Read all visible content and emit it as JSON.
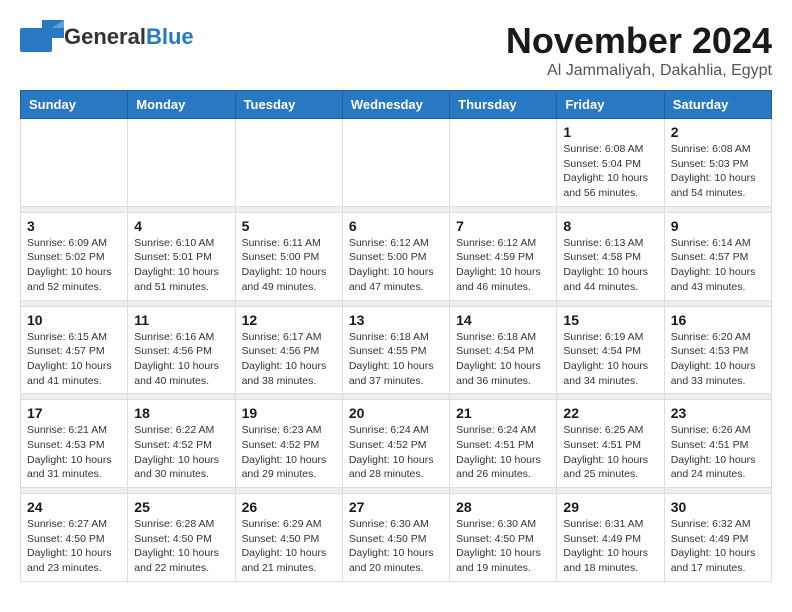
{
  "header": {
    "logo_general": "General",
    "logo_blue": "Blue",
    "month": "November 2024",
    "location": "Al Jammaliyah, Dakahlia, Egypt"
  },
  "weekdays": [
    "Sunday",
    "Monday",
    "Tuesday",
    "Wednesday",
    "Thursday",
    "Friday",
    "Saturday"
  ],
  "weeks": [
    [
      {
        "day": "",
        "info": ""
      },
      {
        "day": "",
        "info": ""
      },
      {
        "day": "",
        "info": ""
      },
      {
        "day": "",
        "info": ""
      },
      {
        "day": "",
        "info": ""
      },
      {
        "day": "1",
        "info": "Sunrise: 6:08 AM\nSunset: 5:04 PM\nDaylight: 10 hours\nand 56 minutes."
      },
      {
        "day": "2",
        "info": "Sunrise: 6:08 AM\nSunset: 5:03 PM\nDaylight: 10 hours\nand 54 minutes."
      }
    ],
    [
      {
        "day": "3",
        "info": "Sunrise: 6:09 AM\nSunset: 5:02 PM\nDaylight: 10 hours\nand 52 minutes."
      },
      {
        "day": "4",
        "info": "Sunrise: 6:10 AM\nSunset: 5:01 PM\nDaylight: 10 hours\nand 51 minutes."
      },
      {
        "day": "5",
        "info": "Sunrise: 6:11 AM\nSunset: 5:00 PM\nDaylight: 10 hours\nand 49 minutes."
      },
      {
        "day": "6",
        "info": "Sunrise: 6:12 AM\nSunset: 5:00 PM\nDaylight: 10 hours\nand 47 minutes."
      },
      {
        "day": "7",
        "info": "Sunrise: 6:12 AM\nSunset: 4:59 PM\nDaylight: 10 hours\nand 46 minutes."
      },
      {
        "day": "8",
        "info": "Sunrise: 6:13 AM\nSunset: 4:58 PM\nDaylight: 10 hours\nand 44 minutes."
      },
      {
        "day": "9",
        "info": "Sunrise: 6:14 AM\nSunset: 4:57 PM\nDaylight: 10 hours\nand 43 minutes."
      }
    ],
    [
      {
        "day": "10",
        "info": "Sunrise: 6:15 AM\nSunset: 4:57 PM\nDaylight: 10 hours\nand 41 minutes."
      },
      {
        "day": "11",
        "info": "Sunrise: 6:16 AM\nSunset: 4:56 PM\nDaylight: 10 hours\nand 40 minutes."
      },
      {
        "day": "12",
        "info": "Sunrise: 6:17 AM\nSunset: 4:56 PM\nDaylight: 10 hours\nand 38 minutes."
      },
      {
        "day": "13",
        "info": "Sunrise: 6:18 AM\nSunset: 4:55 PM\nDaylight: 10 hours\nand 37 minutes."
      },
      {
        "day": "14",
        "info": "Sunrise: 6:18 AM\nSunset: 4:54 PM\nDaylight: 10 hours\nand 36 minutes."
      },
      {
        "day": "15",
        "info": "Sunrise: 6:19 AM\nSunset: 4:54 PM\nDaylight: 10 hours\nand 34 minutes."
      },
      {
        "day": "16",
        "info": "Sunrise: 6:20 AM\nSunset: 4:53 PM\nDaylight: 10 hours\nand 33 minutes."
      }
    ],
    [
      {
        "day": "17",
        "info": "Sunrise: 6:21 AM\nSunset: 4:53 PM\nDaylight: 10 hours\nand 31 minutes."
      },
      {
        "day": "18",
        "info": "Sunrise: 6:22 AM\nSunset: 4:52 PM\nDaylight: 10 hours\nand 30 minutes."
      },
      {
        "day": "19",
        "info": "Sunrise: 6:23 AM\nSunset: 4:52 PM\nDaylight: 10 hours\nand 29 minutes."
      },
      {
        "day": "20",
        "info": "Sunrise: 6:24 AM\nSunset: 4:52 PM\nDaylight: 10 hours\nand 28 minutes."
      },
      {
        "day": "21",
        "info": "Sunrise: 6:24 AM\nSunset: 4:51 PM\nDaylight: 10 hours\nand 26 minutes."
      },
      {
        "day": "22",
        "info": "Sunrise: 6:25 AM\nSunset: 4:51 PM\nDaylight: 10 hours\nand 25 minutes."
      },
      {
        "day": "23",
        "info": "Sunrise: 6:26 AM\nSunset: 4:51 PM\nDaylight: 10 hours\nand 24 minutes."
      }
    ],
    [
      {
        "day": "24",
        "info": "Sunrise: 6:27 AM\nSunset: 4:50 PM\nDaylight: 10 hours\nand 23 minutes."
      },
      {
        "day": "25",
        "info": "Sunrise: 6:28 AM\nSunset: 4:50 PM\nDaylight: 10 hours\nand 22 minutes."
      },
      {
        "day": "26",
        "info": "Sunrise: 6:29 AM\nSunset: 4:50 PM\nDaylight: 10 hours\nand 21 minutes."
      },
      {
        "day": "27",
        "info": "Sunrise: 6:30 AM\nSunset: 4:50 PM\nDaylight: 10 hours\nand 20 minutes."
      },
      {
        "day": "28",
        "info": "Sunrise: 6:30 AM\nSunset: 4:50 PM\nDaylight: 10 hours\nand 19 minutes."
      },
      {
        "day": "29",
        "info": "Sunrise: 6:31 AM\nSunset: 4:49 PM\nDaylight: 10 hours\nand 18 minutes."
      },
      {
        "day": "30",
        "info": "Sunrise: 6:32 AM\nSunset: 4:49 PM\nDaylight: 10 hours\nand 17 minutes."
      }
    ]
  ]
}
